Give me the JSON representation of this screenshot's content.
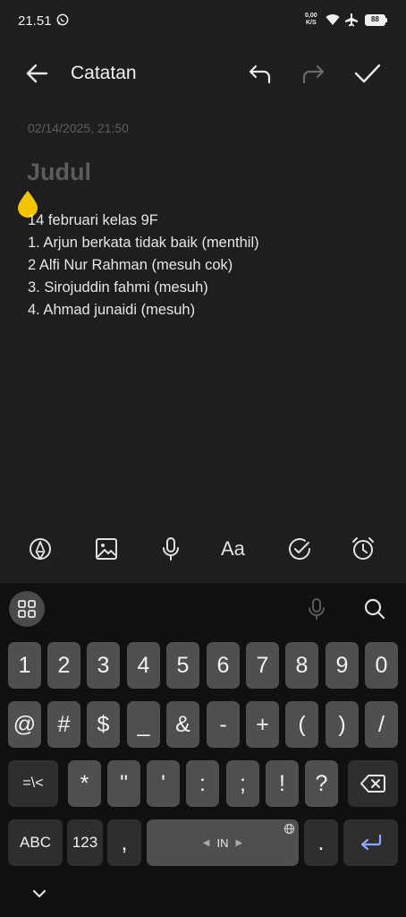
{
  "status_bar": {
    "time": "21.51",
    "net_speed_value": "0,00",
    "net_speed_unit": "K/S",
    "battery": "88",
    "icons": [
      "whatsapp-icon",
      "wifi-icon",
      "airplane-icon",
      "battery-icon"
    ]
  },
  "header": {
    "title": "Catatan",
    "icons": [
      "back-arrow-icon",
      "undo-icon",
      "redo-icon",
      "check-icon"
    ]
  },
  "note": {
    "date": "02/14/2025, 21:50",
    "title_placeholder": "Judul",
    "lines": [
      "14 februari kelas 9F",
      "1. Arjun berkata tidak baik (menthil)",
      "2 Alfi Nur Rahman (mesuh cok)",
      "3. Sirojuddin fahmi (mesuh)",
      "4. Ahmad junaidi (mesuh)"
    ]
  },
  "toolbar": {
    "tools": [
      "pen-icon",
      "image-icon",
      "microphone-icon",
      "text-format-icon",
      "checklist-icon",
      "alarm-icon"
    ],
    "text_format_label": "Aa"
  },
  "keyboard": {
    "row1": [
      "1",
      "2",
      "3",
      "4",
      "5",
      "6",
      "7",
      "8",
      "9",
      "0"
    ],
    "row2": [
      "@",
      "#",
      "$",
      "_",
      "&",
      "-",
      "+",
      "(",
      ")",
      "/"
    ],
    "row3": [
      "=\\<",
      "*",
      "\"",
      "'",
      ":",
      ";",
      "!",
      "?"
    ],
    "row4": {
      "abc": "ABC",
      "num": "123",
      "comma": ",",
      "space_label": "IN",
      "period": "."
    }
  },
  "colors": {
    "background": "#1e1e1e",
    "keyboard_bg": "#101010",
    "key": "#4f4f4f",
    "key_dark": "#2e2e2e",
    "cursor_handle": "#f5c400",
    "enter_icon": "#8fa8ff"
  }
}
